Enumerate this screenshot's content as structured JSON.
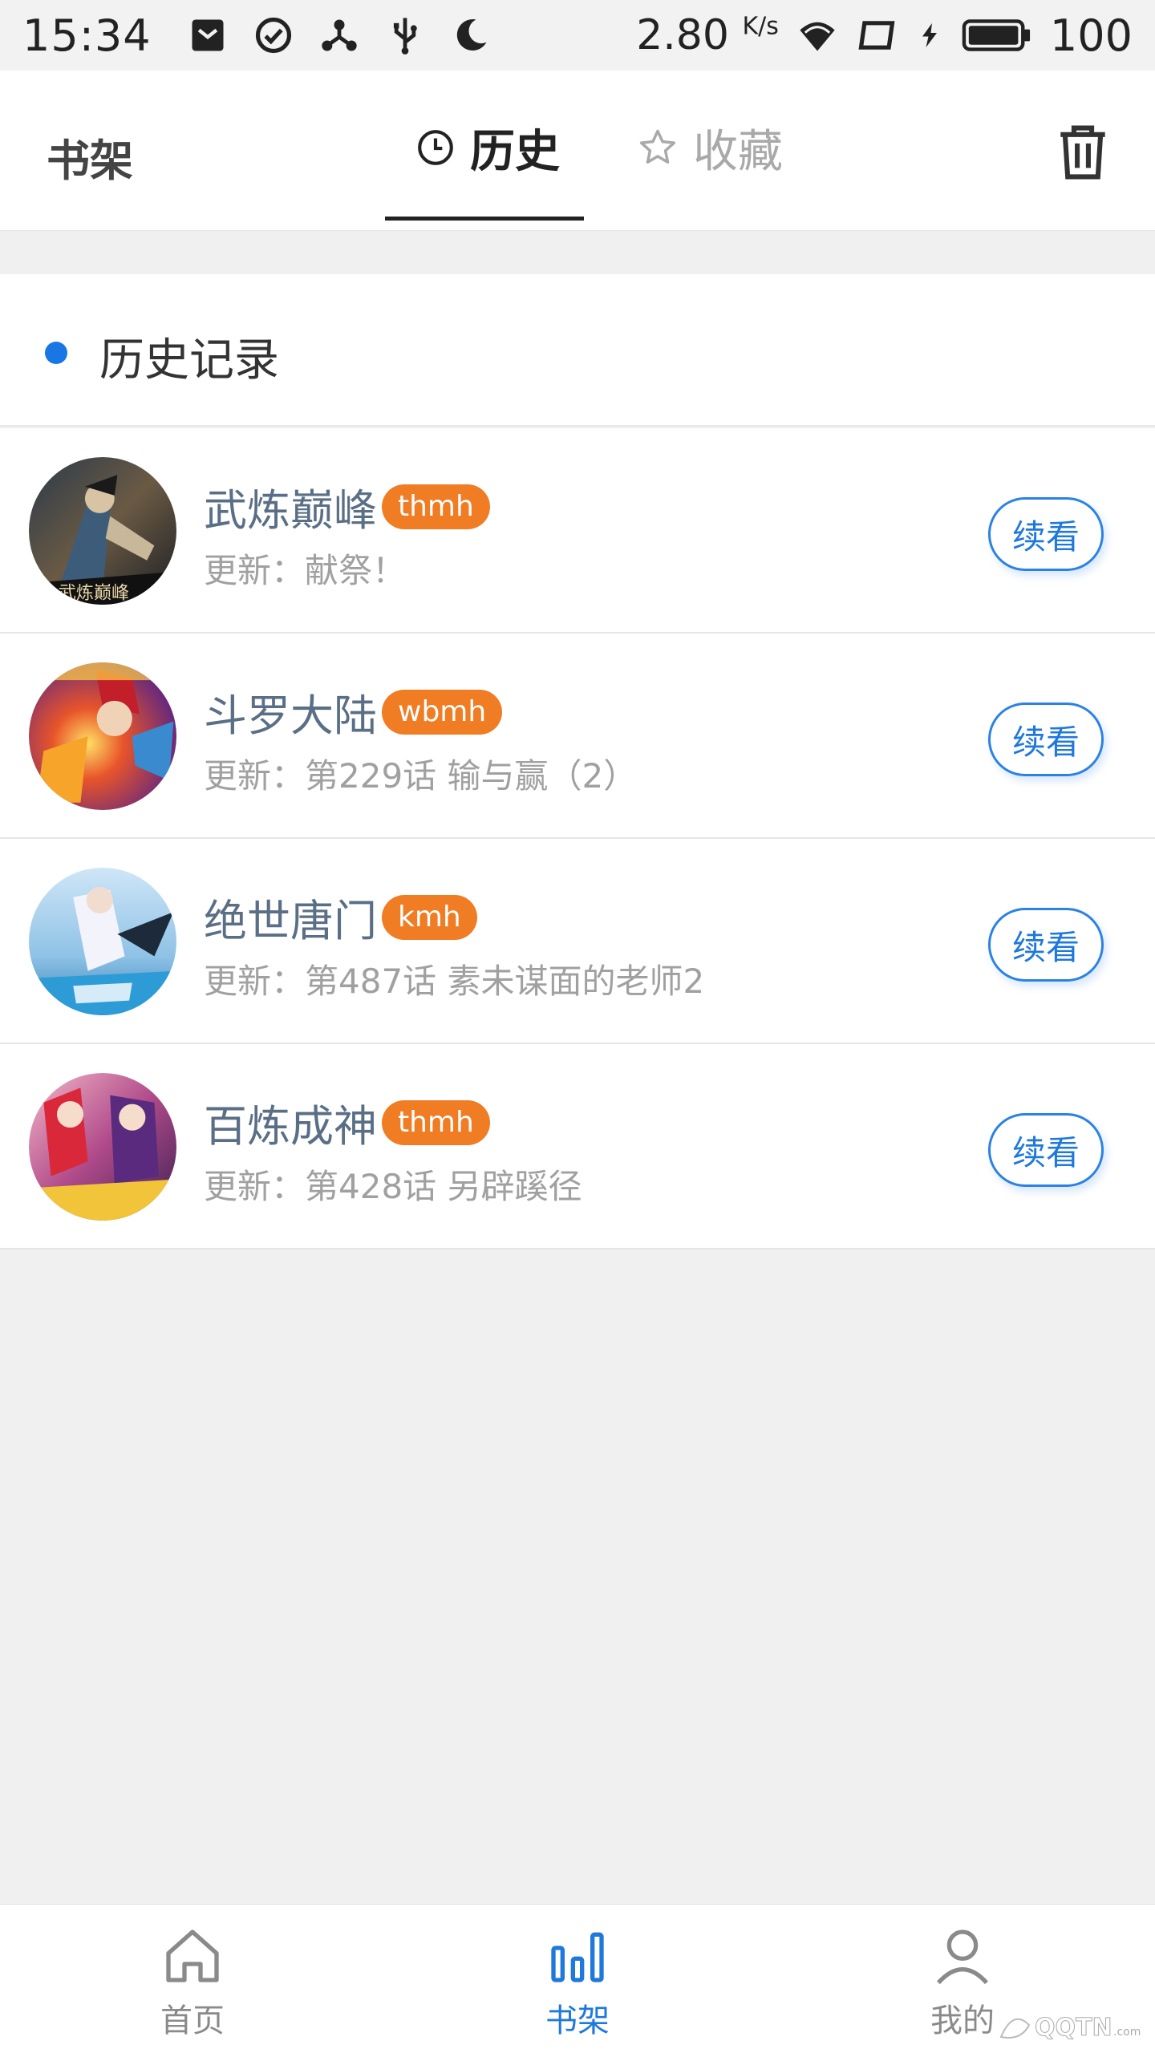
{
  "status_bar": {
    "time": "15:34",
    "speed_value": "2.80",
    "speed_unit": "K/s",
    "battery": "100",
    "icons": [
      "notification-icon",
      "check-circle-icon",
      "share-icon",
      "usb-icon",
      "moon-icon",
      "wifi-icon",
      "screen-icon",
      "charging-icon",
      "battery-icon"
    ]
  },
  "top_nav": {
    "title": "书架",
    "tabs": [
      {
        "label": "历史",
        "icon": "clock-icon",
        "active": true
      },
      {
        "label": "收藏",
        "icon": "star-icon",
        "active": false
      }
    ],
    "delete_icon": "trash-icon"
  },
  "section": {
    "title": "历史记录"
  },
  "items": [
    {
      "title": "武炼巅峰",
      "tag": "thmh",
      "update": "更新：献祭！",
      "button": "续看"
    },
    {
      "title": "斗罗大陆",
      "tag": "wbmh",
      "update": "更新：第229话 输与赢（2）",
      "button": "续看"
    },
    {
      "title": "绝世唐门",
      "tag": "kmh",
      "update": "更新：第487话 素未谋面的老师2",
      "button": "续看"
    },
    {
      "title": "百炼成神",
      "tag": "thmh",
      "update": "更新：第428话 另辟蹊径",
      "button": "续看"
    }
  ],
  "bottom_nav": {
    "items": [
      {
        "label": "首页",
        "icon": "home-icon",
        "active": false
      },
      {
        "label": "书架",
        "icon": "bar-chart-icon",
        "active": true
      },
      {
        "label": "我的",
        "icon": "user-icon",
        "active": false
      }
    ]
  },
  "colors": {
    "accent": "#1f78dc",
    "tag_bg": "#f07c24",
    "title_text": "#5a6f86",
    "page_bg": "#f0f0f0"
  }
}
